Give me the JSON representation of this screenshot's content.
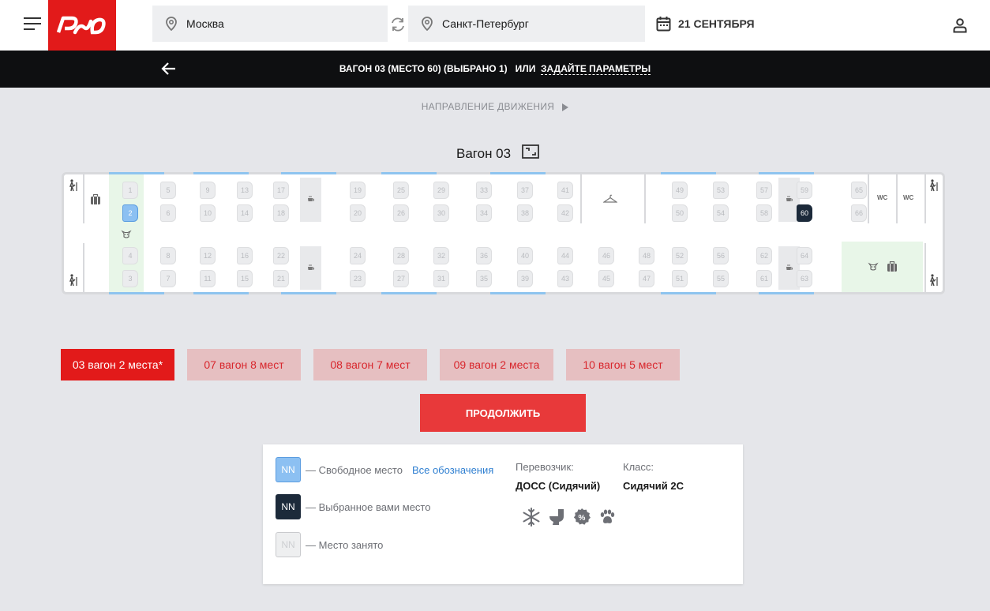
{
  "header": {
    "logo_text": "РЖД",
    "from_city": "Москва",
    "to_city": "Санкт-Петербург",
    "date": "21 СЕНТЯБРЯ"
  },
  "subbar": {
    "selection_text": "ВАГОН 03 (МЕСТО 60) (ВЫБРАНО 1)",
    "or_text": "ИЛИ",
    "params_link": "ЗАДАЙТЕ ПАРАМЕТРЫ"
  },
  "direction_label": "НАПРАВЛЕНИЕ ДВИЖЕНИЯ",
  "wagon": {
    "title": "Вагон 03",
    "wc_label": "WC",
    "free_seats": [
      "2"
    ],
    "selected_seats": [
      "60"
    ],
    "seats": [
      "1",
      "2",
      "3",
      "4",
      "5",
      "6",
      "7",
      "8",
      "9",
      "10",
      "11",
      "12",
      "13",
      "14",
      "15",
      "16",
      "17",
      "18",
      "19",
      "20",
      "21",
      "22",
      "23",
      "24",
      "25",
      "26",
      "27",
      "28",
      "29",
      "30",
      "31",
      "32",
      "33",
      "34",
      "35",
      "36",
      "37",
      "38",
      "39",
      "40",
      "41",
      "42",
      "43",
      "44",
      "45",
      "46",
      "47",
      "48",
      "49",
      "50",
      "51",
      "52",
      "53",
      "54",
      "55",
      "56",
      "57",
      "58",
      "59",
      "60",
      "61",
      "62",
      "63",
      "64",
      "65",
      "66"
    ]
  },
  "cars": [
    {
      "label": "03 вагон 2 места*",
      "active": true
    },
    {
      "label": "07 вагон 8 мест",
      "active": false
    },
    {
      "label": "08 вагон 7 мест",
      "active": false
    },
    {
      "label": "09 вагон 2 места",
      "active": false
    },
    {
      "label": "10 вагон 5 мест",
      "active": false
    }
  ],
  "continue_label": "ПРОДОЛЖИТЬ",
  "legend": {
    "box_text": "NN",
    "free_label": "— Свободное место",
    "selected_label": "— Выбранное вами место",
    "busy_label": "— Место занято",
    "all_legend_link": "Все обозначения",
    "carrier_label": "Перевозчик:",
    "carrier_value": "ДОСС (Сидячий)",
    "class_label": "Класс:",
    "class_value": "Сидячий 2С",
    "services": [
      "snowflake-icon",
      "toilet-icon",
      "discount-icon",
      "paw-icon"
    ]
  },
  "colors": {
    "brand_red": "#e21a1a",
    "free_seat": "#8cc0f2",
    "selected_seat": "#1c2a3a"
  }
}
